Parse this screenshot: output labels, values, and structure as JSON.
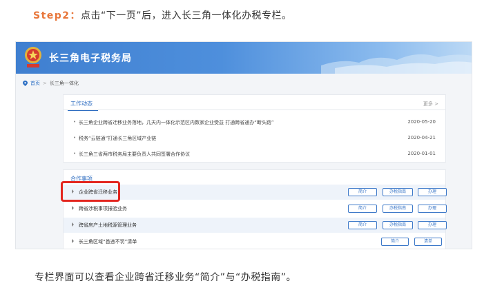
{
  "step": {
    "label": "Step2：",
    "text": "点击“下一页”后，进入长三角一体化办税专栏。"
  },
  "header": {
    "title": "长三角电子税务局",
    "emblem_icon": "tax-emblem-icon"
  },
  "breadcrumb": {
    "home": "首页",
    "sep": ">",
    "current": "长三角一体化"
  },
  "news": {
    "title": "工作动态",
    "more": "更多 >",
    "items": [
      {
        "text": "长三角企业跨省迁移业务落地，几天内一体化示范区内数家企业受益 打通跨省通办“断头路”",
        "date": "2020-05-20"
      },
      {
        "text": "税务“云链通”打通长三角区域产业链",
        "date": "2020-04-21"
      },
      {
        "text": "长三角三省两市税务局主要负责人共同签署合作协议",
        "date": "2020-01-01"
      }
    ]
  },
  "business": {
    "title": "合作事项",
    "items": [
      {
        "name": "企业跨省迁移业务",
        "buttons": [
          "简介",
          "办税指南",
          "办理"
        ]
      },
      {
        "name": "跨省涉税事项报验业务",
        "buttons": [
          "简介",
          "办税指南",
          "办理"
        ]
      },
      {
        "name": "跨省房产土地税源管理业务",
        "buttons": [
          "简介",
          "办税指南",
          "办理"
        ]
      },
      {
        "name": "长三角区域“首违不罚”清单",
        "buttons": [
          "简介",
          "清单"
        ]
      }
    ]
  },
  "caption": "专栏界面可以查看企业跨省迁移业务“简介”与“办税指南”。",
  "colors": {
    "accent": "#2d6cc0",
    "step": "#e8763a",
    "highlight": "#e3261f",
    "banner": "#3f7fd0"
  }
}
